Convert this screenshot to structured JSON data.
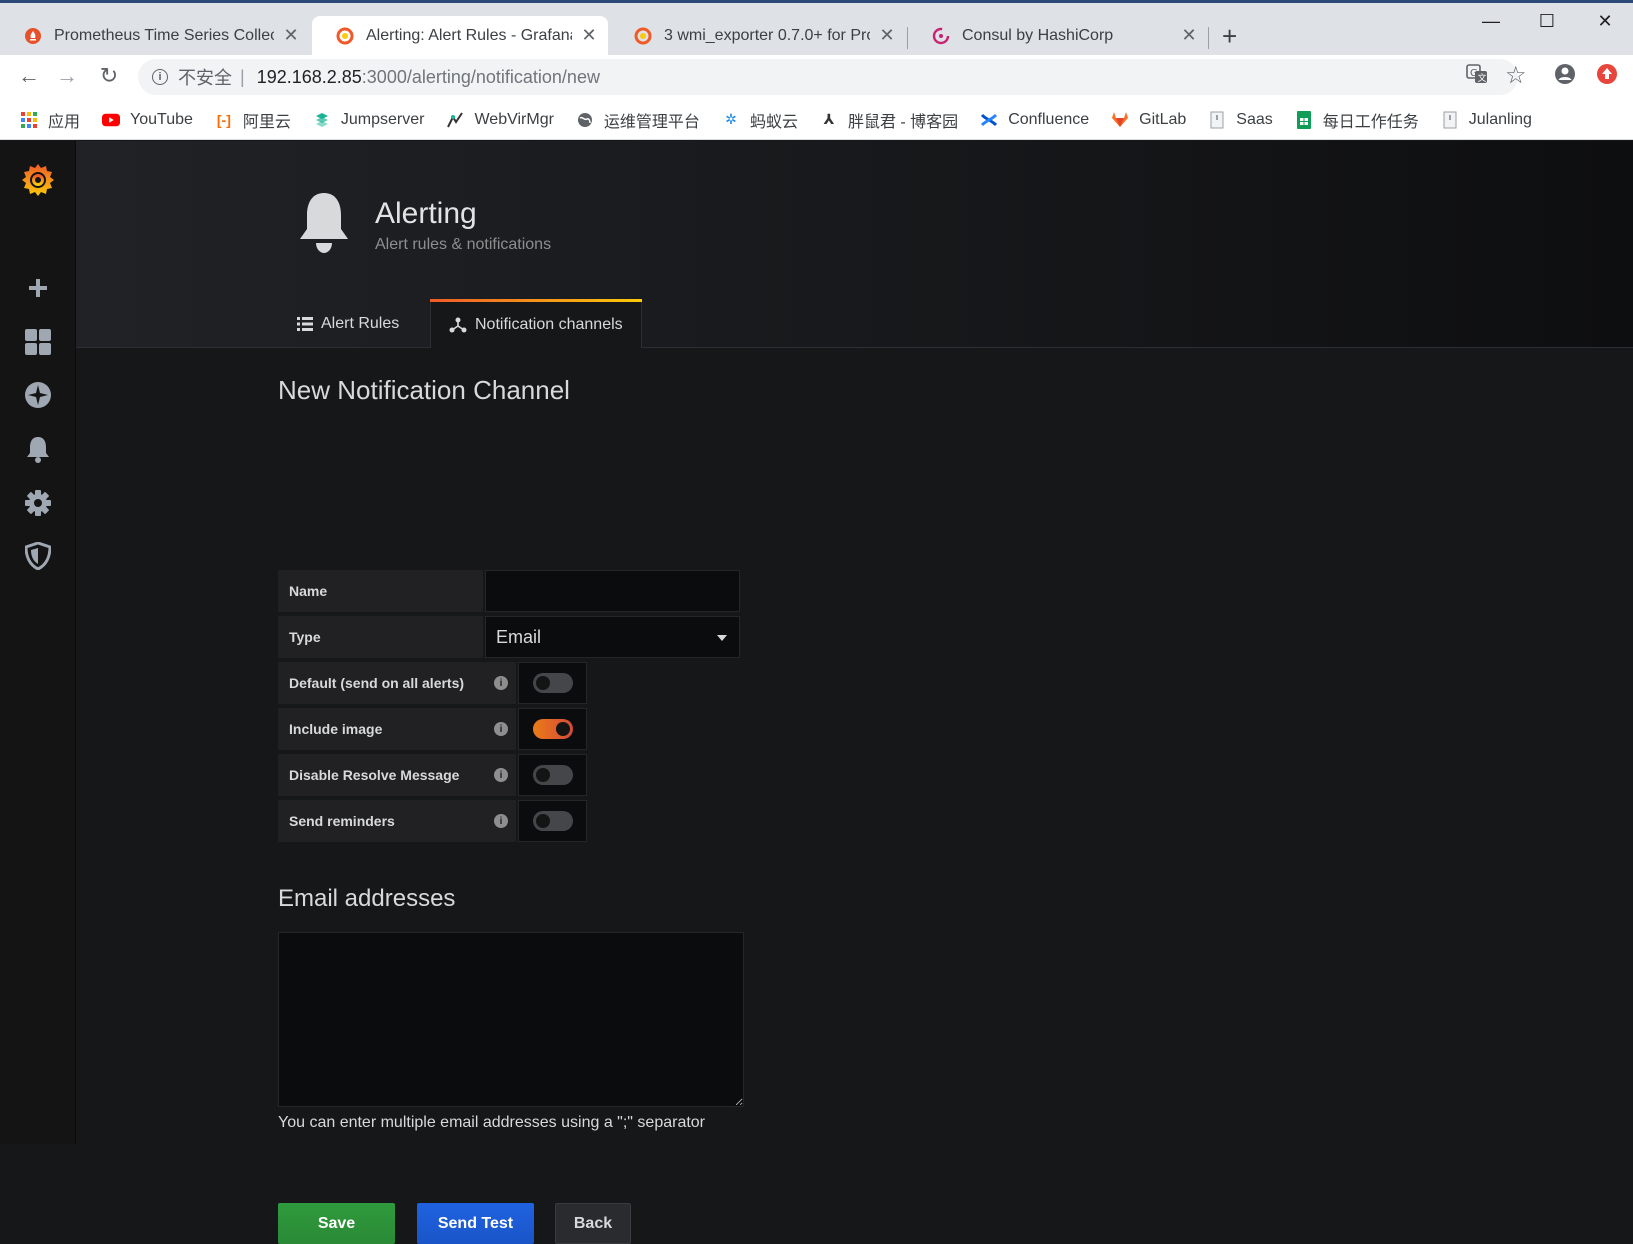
{
  "browser": {
    "tabs": [
      {
        "title": "Prometheus Time Series Collec",
        "favicon": "prometheus-icon",
        "active": false
      },
      {
        "title": "Alerting: Alert Rules - Grafana",
        "favicon": "grafana-icon",
        "active": true
      },
      {
        "title": "3 wmi_exporter 0.7.0+ for Pro",
        "favicon": "grafana-icon",
        "active": false
      },
      {
        "title": "Consul by HashiCorp",
        "favicon": "consul-icon",
        "active": false
      }
    ],
    "new_tab": "+",
    "window_controls": {
      "minimize": "—",
      "maximize": "☐",
      "close": "✕"
    },
    "address": {
      "security_label": "不安全",
      "separator": "|",
      "host": "192.168.2.85",
      "path": ":3000/alerting/notification/new"
    },
    "bookmarks": [
      {
        "label": "应用",
        "icon": "apps-grid-icon",
        "color": "#e94235"
      },
      {
        "label": "YouTube",
        "icon": "youtube-icon",
        "color": "#ff0000"
      },
      {
        "label": "阿里云",
        "icon": "aliyun-icon",
        "color": "#ff6a00"
      },
      {
        "label": "Jumpserver",
        "icon": "jumpserver-icon",
        "color": "#1ab394"
      },
      {
        "label": "WebVirMgr",
        "icon": "webvirmgr-icon",
        "color": "#333333"
      },
      {
        "label": "运维管理平台",
        "icon": "globe-icon",
        "color": "#5f6368"
      },
      {
        "label": "蚂蚁云",
        "icon": "ant-icon",
        "color": "#1e88e5"
      },
      {
        "label": "胖鼠君 - 博客园",
        "icon": "blog-icon",
        "color": "#333333"
      },
      {
        "label": "Confluence",
        "icon": "confluence-icon",
        "color": "#0052cc"
      },
      {
        "label": "GitLab",
        "icon": "gitlab-icon",
        "color": "#fc6d26"
      },
      {
        "label": "Saas",
        "icon": "page-icon",
        "color": "#9aa0a6"
      },
      {
        "label": "每日工作任务",
        "icon": "sheets-icon",
        "color": "#0f9d58"
      },
      {
        "label": "Julanling",
        "icon": "page-icon",
        "color": "#9aa0a6"
      }
    ]
  },
  "grafana": {
    "sidemenu": [
      {
        "name": "grafana-logo-icon"
      },
      {
        "name": "plus-icon"
      },
      {
        "name": "dashboards-icon"
      },
      {
        "name": "explore-icon"
      },
      {
        "name": "alerting-bell-icon"
      },
      {
        "name": "configuration-gear-icon"
      },
      {
        "name": "admin-shield-icon"
      }
    ],
    "header": {
      "title": "Alerting",
      "subtitle": "Alert rules & notifications"
    },
    "page_tabs": [
      {
        "label": "Alert Rules",
        "icon": "list-icon",
        "active": false
      },
      {
        "label": "Notification channels",
        "icon": "share-network-icon",
        "active": true
      }
    ],
    "form": {
      "heading": "New Notification Channel",
      "name": {
        "label": "Name",
        "value": ""
      },
      "type": {
        "label": "Type",
        "value": "Email"
      },
      "toggles": [
        {
          "label": "Default (send on all alerts)",
          "on": false
        },
        {
          "label": "Include image",
          "on": true
        },
        {
          "label": "Disable Resolve Message",
          "on": false
        },
        {
          "label": "Send reminders",
          "on": false
        }
      ],
      "info_glyph": "i",
      "email": {
        "heading": "Email addresses",
        "value": "",
        "help": "You can enter multiple email addresses using a \";\" separator"
      },
      "buttons": {
        "save": "Save",
        "test": "Send Test",
        "back": "Back"
      }
    },
    "colors": {
      "accent_orange": "#eb7b18",
      "save_green": "#299c46",
      "test_blue": "#1f62e0"
    }
  }
}
